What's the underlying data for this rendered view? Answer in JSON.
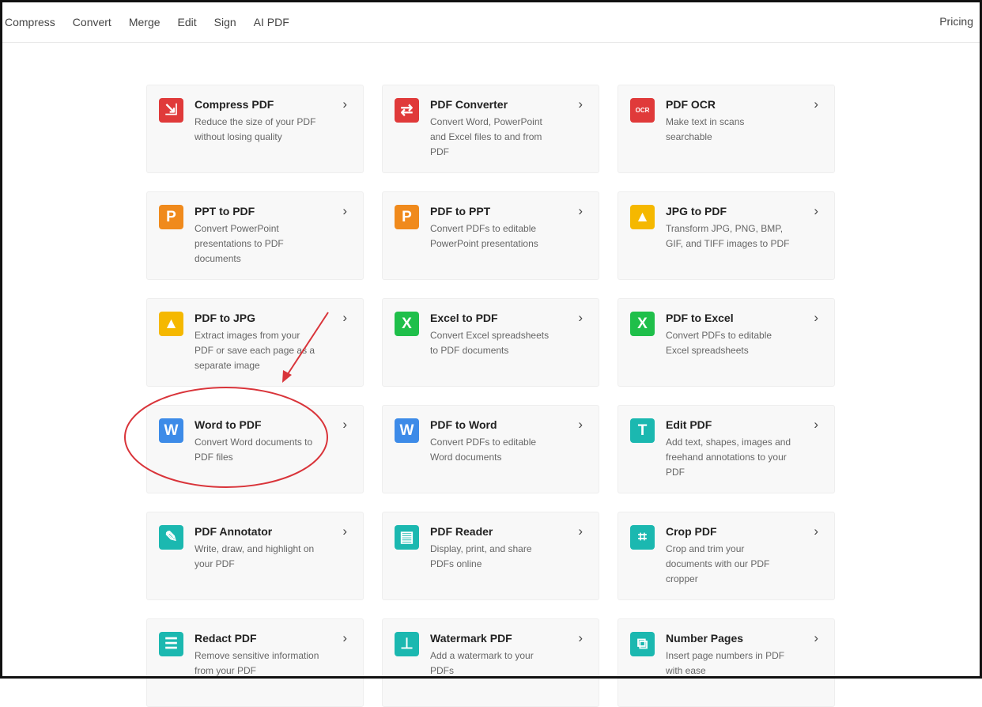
{
  "nav": {
    "items": [
      "Compress",
      "Convert",
      "Merge",
      "Edit",
      "Sign",
      "AI PDF"
    ],
    "pricing": "Pricing"
  },
  "tools": [
    {
      "title": "Compress PDF",
      "desc": "Reduce the size of your PDF without losing quality",
      "icon": "compress-icon",
      "glyph": "⇲",
      "color": "#e03a3a"
    },
    {
      "title": "PDF Converter",
      "desc": "Convert Word, PowerPoint and Excel files to and from PDF",
      "icon": "convert-icon",
      "glyph": "⇄",
      "color": "#e03a3a"
    },
    {
      "title": "PDF OCR",
      "desc": "Make text in scans searchable",
      "icon": "ocr-icon",
      "glyph": "OCR",
      "color": "#e03a3a"
    },
    {
      "title": "PPT to PDF",
      "desc": "Convert PowerPoint presentations to PDF documents",
      "icon": "powerpoint-icon",
      "glyph": "P",
      "color": "#f08a1c"
    },
    {
      "title": "PDF to PPT",
      "desc": "Convert PDFs to editable PowerPoint presentations",
      "icon": "powerpoint-icon",
      "glyph": "P",
      "color": "#f08a1c"
    },
    {
      "title": "JPG to PDF",
      "desc": "Transform JPG, PNG, BMP, GIF, and TIFF images to PDF",
      "icon": "image-icon",
      "glyph": "▲",
      "color": "#f5b800"
    },
    {
      "title": "PDF to JPG",
      "desc": "Extract images from your PDF or save each page as a separate image",
      "icon": "image-icon",
      "glyph": "▲",
      "color": "#f5b800"
    },
    {
      "title": "Excel to PDF",
      "desc": "Convert Excel spreadsheets to PDF documents",
      "icon": "excel-icon",
      "glyph": "X",
      "color": "#1fbf4a"
    },
    {
      "title": "PDF to Excel",
      "desc": "Convert PDFs to editable Excel spreadsheets",
      "icon": "excel-icon",
      "glyph": "X",
      "color": "#1fbf4a"
    },
    {
      "title": "Word to PDF",
      "desc": "Convert Word documents to PDF files",
      "icon": "word-icon",
      "glyph": "W",
      "color": "#3d8be8"
    },
    {
      "title": "PDF to Word",
      "desc": "Convert PDFs to editable Word documents",
      "icon": "word-icon",
      "glyph": "W",
      "color": "#3d8be8"
    },
    {
      "title": "Edit PDF",
      "desc": "Add text, shapes, images and freehand annotations to your PDF",
      "icon": "text-edit-icon",
      "glyph": "T",
      "color": "#1bb8b0"
    },
    {
      "title": "PDF Annotator",
      "desc": "Write, draw, and highlight on your PDF",
      "icon": "pencil-icon",
      "glyph": "✎",
      "color": "#1bb8b0"
    },
    {
      "title": "PDF Reader",
      "desc": "Display, print, and share PDFs online",
      "icon": "document-icon",
      "glyph": "▤",
      "color": "#1bb8b0"
    },
    {
      "title": "Crop PDF",
      "desc": "Crop and trim your documents with our PDF cropper",
      "icon": "crop-icon",
      "glyph": "⌗",
      "color": "#1bb8b0"
    },
    {
      "title": "Redact PDF",
      "desc": "Remove sensitive information from your PDF",
      "icon": "redact-icon",
      "glyph": "☰",
      "color": "#1bb8b0"
    },
    {
      "title": "Watermark PDF",
      "desc": "Add a watermark to your PDFs",
      "icon": "stamp-icon",
      "glyph": "⊥",
      "color": "#1bb8b0"
    },
    {
      "title": "Number Pages",
      "desc": "Insert page numbers in PDF with ease",
      "icon": "page-numbers-icon",
      "glyph": "⧉",
      "color": "#1bb8b0"
    }
  ],
  "chevron": "›"
}
